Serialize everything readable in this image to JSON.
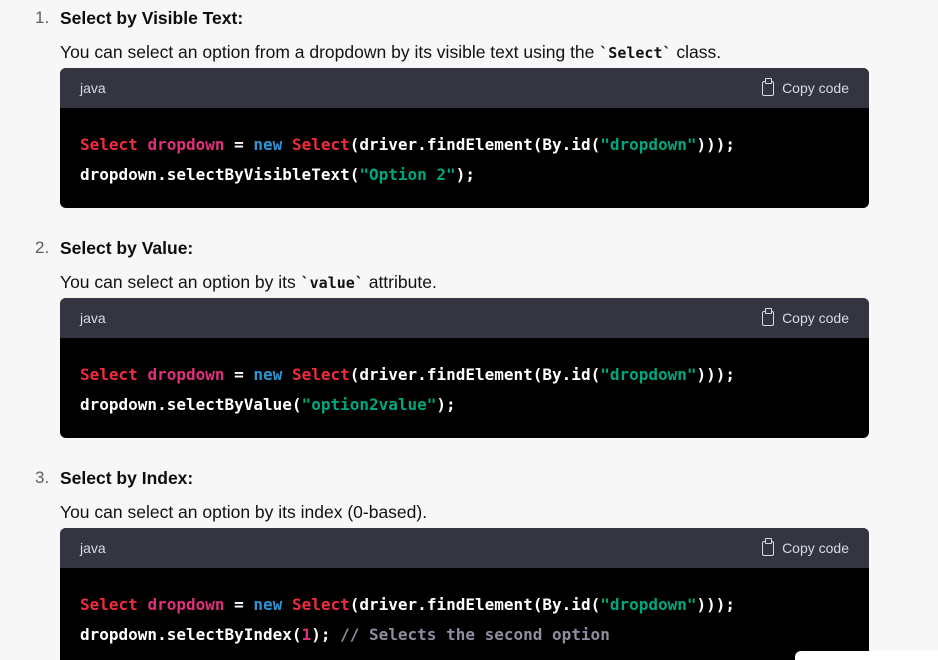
{
  "items": [
    {
      "number": "1.",
      "heading": "Select by Visible Text:",
      "desc_pre": "You can select an option from a dropdown by its visible text using the ",
      "desc_code": "`Select`",
      "desc_post": " class.",
      "lang": "java",
      "copy_label": "Copy code",
      "code": {
        "l1_type": "Select",
        "l1_var": "dropdown",
        "l1_eq": " = ",
        "l1_new": "new",
        "l1_sp": " ",
        "l1_cls": "Select",
        "l1_call": "(driver.findElement(By.id(",
        "l1_str": "\"dropdown\"",
        "l1_end": ")));",
        "l2_call": "dropdown.selectByVisibleText(",
        "l2_str": "\"Option 2\"",
        "l2_end": ");"
      }
    },
    {
      "number": "2.",
      "heading": "Select by Value:",
      "desc_pre": "You can select an option by its ",
      "desc_code": "`value`",
      "desc_post": " attribute.",
      "lang": "java",
      "copy_label": "Copy code",
      "code": {
        "l1_type": "Select",
        "l1_var": "dropdown",
        "l1_eq": " = ",
        "l1_new": "new",
        "l1_sp": " ",
        "l1_cls": "Select",
        "l1_call": "(driver.findElement(By.id(",
        "l1_str": "\"dropdown\"",
        "l1_end": ")));",
        "l2_call": "dropdown.selectByValue(",
        "l2_str": "\"option2value\"",
        "l2_end": ");"
      }
    },
    {
      "number": "3.",
      "heading": "Select by Index:",
      "desc_pre": "You can select an option by its index (0-based).",
      "desc_code": "",
      "desc_post": "",
      "lang": "java",
      "copy_label": "Copy code",
      "code": {
        "l1_type": "Select",
        "l1_var": "dropdown",
        "l1_eq": " = ",
        "l1_new": "new",
        "l1_sp": " ",
        "l1_cls": "Select",
        "l1_call": "(driver.findElement(By.id(",
        "l1_str": "\"dropdown\"",
        "l1_end": ")));",
        "l2_call": "dropdown.selectByIndex(",
        "l2_num": "1",
        "l2_end": ");",
        "l2_cmt": " // Selects the second option"
      }
    }
  ],
  "colors": {
    "page_bg": "#f7f7f8",
    "code_header_bg": "#343541",
    "code_bg": "#000000",
    "keyword": "#f22c3d",
    "variable": "#df3079",
    "new_keyword": "#2e95d3",
    "string": "#00a67d",
    "comment": "#8e8ea0"
  }
}
